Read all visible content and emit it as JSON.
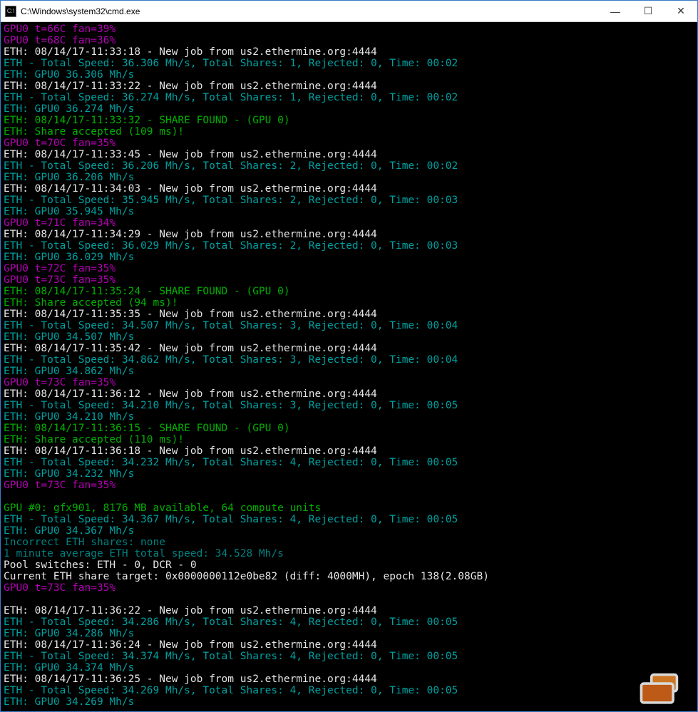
{
  "window": {
    "title": "C:\\Windows\\system32\\cmd.exe",
    "icon_label": "C:\\",
    "min": "—",
    "max": "☐",
    "close": "✕"
  },
  "lines": [
    {
      "cls": "m",
      "t": "GPU0 t=66C fan=39%"
    },
    {
      "cls": "m",
      "t": "GPU0 t=68C fan=36%"
    },
    {
      "cls": "w",
      "t": "ETH: 08/14/17-11:33:18 - New job from us2.ethermine.org:4444"
    },
    {
      "cls": "c",
      "t": "ETH - Total Speed: 36.306 Mh/s, Total Shares: 1, Rejected: 0, Time: 00:02"
    },
    {
      "cls": "c",
      "t": "ETH: GPU0 36.306 Mh/s"
    },
    {
      "cls": "w",
      "t": "ETH: 08/14/17-11:33:22 - New job from us2.ethermine.org:4444"
    },
    {
      "cls": "c",
      "t": "ETH - Total Speed: 36.274 Mh/s, Total Shares: 1, Rejected: 0, Time: 00:02"
    },
    {
      "cls": "c",
      "t": "ETH: GPU0 36.274 Mh/s"
    },
    {
      "cls": "g",
      "t": "ETH: 08/14/17-11:33:32 - SHARE FOUND - (GPU 0)"
    },
    {
      "cls": "g",
      "t": "ETH: Share accepted (109 ms)!"
    },
    {
      "cls": "m",
      "t": "GPU0 t=70C fan=35%"
    },
    {
      "cls": "w",
      "t": "ETH: 08/14/17-11:33:45 - New job from us2.ethermine.org:4444"
    },
    {
      "cls": "c",
      "t": "ETH - Total Speed: 36.206 Mh/s, Total Shares: 2, Rejected: 0, Time: 00:02"
    },
    {
      "cls": "c",
      "t": "ETH: GPU0 36.206 Mh/s"
    },
    {
      "cls": "w",
      "t": "ETH: 08/14/17-11:34:03 - New job from us2.ethermine.org:4444"
    },
    {
      "cls": "c",
      "t": "ETH - Total Speed: 35.945 Mh/s, Total Shares: 2, Rejected: 0, Time: 00:03"
    },
    {
      "cls": "c",
      "t": "ETH: GPU0 35.945 Mh/s"
    },
    {
      "cls": "m",
      "t": "GPU0 t=71C fan=34%"
    },
    {
      "cls": "w",
      "t": "ETH: 08/14/17-11:34:29 - New job from us2.ethermine.org:4444"
    },
    {
      "cls": "c",
      "t": "ETH - Total Speed: 36.029 Mh/s, Total Shares: 2, Rejected: 0, Time: 00:03"
    },
    {
      "cls": "c",
      "t": "ETH: GPU0 36.029 Mh/s"
    },
    {
      "cls": "m",
      "t": "GPU0 t=72C fan=35%"
    },
    {
      "cls": "m",
      "t": "GPU0 t=73C fan=35%"
    },
    {
      "cls": "g",
      "t": "ETH: 08/14/17-11:35:24 - SHARE FOUND - (GPU 0)"
    },
    {
      "cls": "g",
      "t": "ETH: Share accepted (94 ms)!"
    },
    {
      "cls": "w",
      "t": "ETH: 08/14/17-11:35:35 - New job from us2.ethermine.org:4444"
    },
    {
      "cls": "c",
      "t": "ETH - Total Speed: 34.507 Mh/s, Total Shares: 3, Rejected: 0, Time: 00:04"
    },
    {
      "cls": "c",
      "t": "ETH: GPU0 34.507 Mh/s"
    },
    {
      "cls": "w",
      "t": "ETH: 08/14/17-11:35:42 - New job from us2.ethermine.org:4444"
    },
    {
      "cls": "c",
      "t": "ETH - Total Speed: 34.862 Mh/s, Total Shares: 3, Rejected: 0, Time: 00:04"
    },
    {
      "cls": "c",
      "t": "ETH: GPU0 34.862 Mh/s"
    },
    {
      "cls": "m",
      "t": "GPU0 t=73C fan=35%"
    },
    {
      "cls": "w",
      "t": "ETH: 08/14/17-11:36:12 - New job from us2.ethermine.org:4444"
    },
    {
      "cls": "c",
      "t": "ETH - Total Speed: 34.210 Mh/s, Total Shares: 3, Rejected: 0, Time: 00:05"
    },
    {
      "cls": "c",
      "t": "ETH: GPU0 34.210 Mh/s"
    },
    {
      "cls": "g",
      "t": "ETH: 08/14/17-11:36:15 - SHARE FOUND - (GPU 0)"
    },
    {
      "cls": "g",
      "t": "ETH: Share accepted (110 ms)!"
    },
    {
      "cls": "w",
      "t": "ETH: 08/14/17-11:36:18 - New job from us2.ethermine.org:4444"
    },
    {
      "cls": "c",
      "t": "ETH - Total Speed: 34.232 Mh/s, Total Shares: 4, Rejected: 0, Time: 00:05"
    },
    {
      "cls": "c",
      "t": "ETH: GPU0 34.232 Mh/s"
    },
    {
      "cls": "m",
      "t": "GPU0 t=73C fan=35%"
    },
    {
      "cls": "blank",
      "t": ""
    },
    {
      "cls": "g",
      "t": "GPU #0: gfx901, 8176 MB available, 64 compute units"
    },
    {
      "cls": "c",
      "t": "ETH - Total Speed: 34.367 Mh/s, Total Shares: 4, Rejected: 0, Time: 00:05"
    },
    {
      "cls": "c",
      "t": "ETH: GPU0 34.367 Mh/s"
    },
    {
      "cls": "d",
      "t": "Incorrect ETH shares: none"
    },
    {
      "cls": "d",
      "t": "1 minute average ETH total speed: 34.528 Mh/s"
    },
    {
      "cls": "w",
      "t": "Pool switches: ETH - 0, DCR - 0"
    },
    {
      "cls": "w",
      "t": "Current ETH share target: 0x0000000112e0be82 (diff: 4000MH), epoch 138(2.08GB)"
    },
    {
      "cls": "m",
      "t": "GPU0 t=73C fan=35%"
    },
    {
      "cls": "blank",
      "t": ""
    },
    {
      "cls": "w",
      "t": "ETH: 08/14/17-11:36:22 - New job from us2.ethermine.org:4444"
    },
    {
      "cls": "c",
      "t": "ETH - Total Speed: 34.286 Mh/s, Total Shares: 4, Rejected: 0, Time: 00:05"
    },
    {
      "cls": "c",
      "t": "ETH: GPU0 34.286 Mh/s"
    },
    {
      "cls": "w",
      "t": "ETH: 08/14/17-11:36:24 - New job from us2.ethermine.org:4444"
    },
    {
      "cls": "c",
      "t": "ETH - Total Speed: 34.374 Mh/s, Total Shares: 4, Rejected: 0, Time: 00:05"
    },
    {
      "cls": "c",
      "t": "ETH: GPU0 34.374 Mh/s"
    },
    {
      "cls": "w",
      "t": "ETH: 08/14/17-11:36:25 - New job from us2.ethermine.org:4444"
    },
    {
      "cls": "c",
      "t": "ETH - Total Speed: 34.269 Mh/s, Total Shares: 4, Rejected: 0, Time: 00:05"
    },
    {
      "cls": "c",
      "t": "ETH: GPU0 34.269 Mh/s"
    }
  ]
}
